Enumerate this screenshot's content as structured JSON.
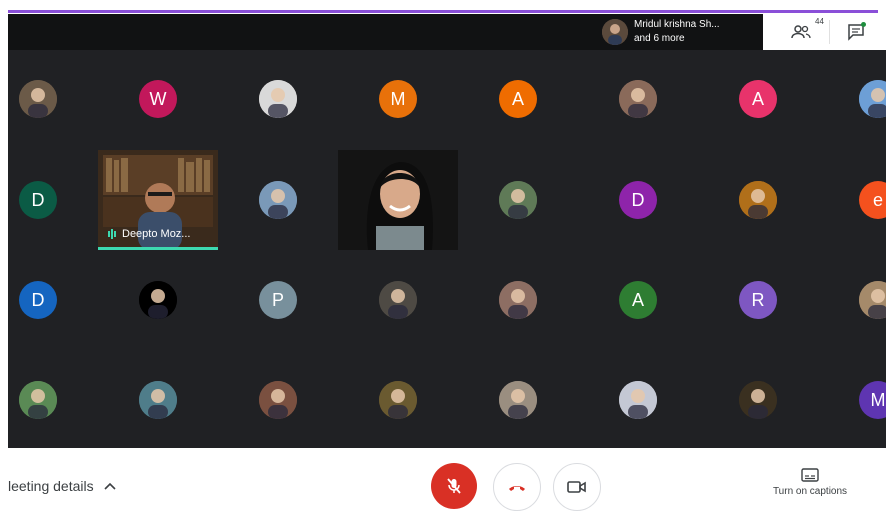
{
  "header": {
    "presenter_line1": "Mridul krishna Sh...",
    "presenter_line2": "and 6 more",
    "people_count": "44"
  },
  "tiles": [
    {
      "type": "photo",
      "color": "#6b5a48"
    },
    {
      "type": "letter",
      "letter": "W",
      "color": "#c2185b"
    },
    {
      "type": "photo",
      "color": "#d9d9d9"
    },
    {
      "type": "letter",
      "letter": "M",
      "color": "#e8710a"
    },
    {
      "type": "letter",
      "letter": "A",
      "color": "#ef6c00"
    },
    {
      "type": "photo",
      "color": "#8a6a5a"
    },
    {
      "type": "letter",
      "letter": "A",
      "color": "#e8336b"
    },
    {
      "type": "photo",
      "color": "#6d9fd6"
    },
    {
      "type": "letter",
      "letter": "D",
      "color": "#0b5b45"
    },
    {
      "type": "photo",
      "color": "#7a99b8"
    },
    {
      "type": "photo",
      "color": "#5f7a57"
    },
    {
      "type": "letter",
      "letter": "D",
      "color": "#8e24aa"
    },
    {
      "type": "photo",
      "color": "#b06f1a"
    },
    {
      "type": "letter",
      "letter": "e",
      "color": "#f4511e"
    },
    {
      "type": "letter",
      "letter": "D",
      "color": "#1565c0"
    },
    {
      "type": "photo",
      "color": "#000000"
    },
    {
      "type": "letter",
      "letter": "P",
      "color": "#78909c"
    },
    {
      "type": "photo",
      "color": "#4e4a44"
    },
    {
      "type": "photo",
      "color": "#8d6e63"
    },
    {
      "type": "letter",
      "letter": "A",
      "color": "#2e7d32"
    },
    {
      "type": "letter",
      "letter": "R",
      "color": "#7e57c2"
    },
    {
      "type": "photo",
      "color": "#a58a6a"
    },
    {
      "type": "photo",
      "color": "#5a8a55"
    },
    {
      "type": "photo",
      "color": "#4f7d8a"
    },
    {
      "type": "photo",
      "color": "#7a5040"
    },
    {
      "type": "photo",
      "color": "#6a5a30"
    },
    {
      "type": "photo",
      "color": "#9a8e80"
    },
    {
      "type": "photo",
      "color": "#c4c8d4"
    },
    {
      "type": "photo",
      "color": "#3a3020"
    },
    {
      "type": "letter",
      "letter": "M",
      "color": "#5e35b1"
    }
  ],
  "videos": [
    {
      "name": "Deepto Moz...",
      "speaking": true
    },
    {
      "name": "",
      "speaking": false
    }
  ],
  "footer": {
    "meeting_details_label": "leeting details",
    "captions_label": "Turn on captions"
  },
  "colors": {
    "accent_purple": "#8a4fd8",
    "grid_bg": "#202124",
    "mic_red": "#d93025",
    "speaking_green": "#3dd9b0"
  }
}
